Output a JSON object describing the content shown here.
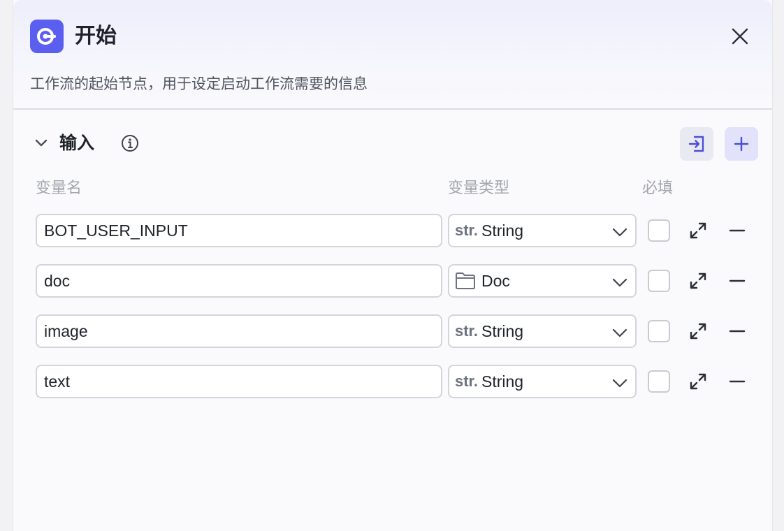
{
  "node": {
    "title": "开始",
    "description": "工作流的起始节点，用于设定启动工作流需要的信息",
    "icon": "start-node-icon",
    "accent_color": "#5b5ff0"
  },
  "input_section": {
    "title": "输入",
    "columns": {
      "name": "变量名",
      "type": "变量类型",
      "required": "必填"
    },
    "rows": [
      {
        "name": "BOT_USER_INPUT",
        "type_prefix": "str.",
        "type": "String",
        "type_icon": "string-type-icon",
        "required": false
      },
      {
        "name": "doc",
        "type_prefix": "",
        "type": "Doc",
        "type_icon": "folder-icon",
        "required": false
      },
      {
        "name": "image",
        "type_prefix": "str.",
        "type": "String",
        "type_icon": "string-type-icon",
        "required": false
      },
      {
        "name": "text",
        "type_prefix": "str.",
        "type": "String",
        "type_icon": "string-type-icon",
        "required": false
      }
    ]
  }
}
